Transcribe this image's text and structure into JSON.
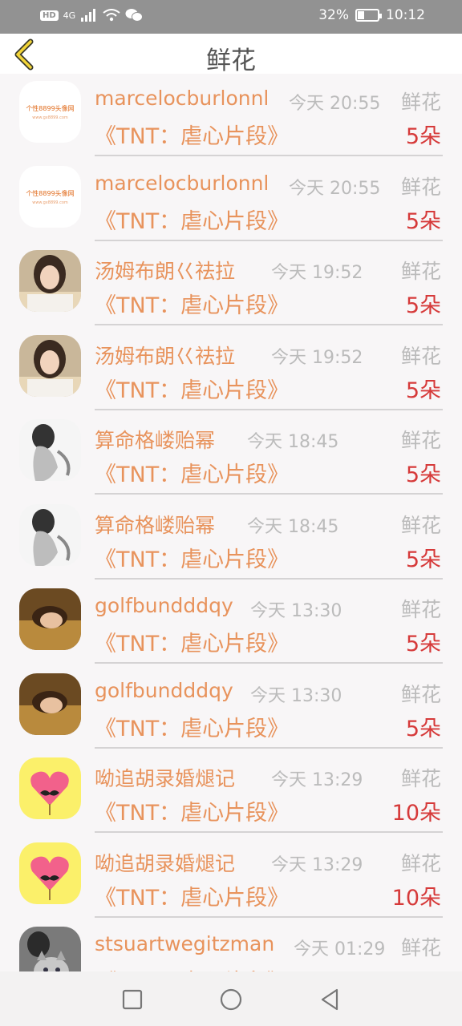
{
  "status_bar": {
    "hd": "HD",
    "network": "4G",
    "battery_pct": "32%",
    "battery_level": 0.32,
    "time": "10:12"
  },
  "header": {
    "title": "鲜花"
  },
  "gifts": [
    {
      "user": "marcelocburlonnl",
      "time": "今天 20:55",
      "kind": "鲜花",
      "movie": "《TNT：虐心片段》",
      "count": "5朵",
      "avatar": "logo-avatar"
    },
    {
      "user": "marcelocburlonnl",
      "time": "今天 20:55",
      "kind": "鲜花",
      "movie": "《TNT：虐心片段》",
      "count": "5朵",
      "avatar": "logo-avatar"
    },
    {
      "user": "汤姆布朗巜祛拉",
      "time": "今天 19:52",
      "kind": "鲜花",
      "movie": "《TNT：虐心片段》",
      "count": "5朵",
      "avatar": "girl-photo-avatar"
    },
    {
      "user": "汤姆布朗巜祛拉",
      "time": "今天 19:52",
      "kind": "鲜花",
      "movie": "《TNT：虐心片段》",
      "count": "5朵",
      "avatar": "girl-photo-avatar"
    },
    {
      "user": "算命格嵝贻幂",
      "time": "今天 18:45",
      "kind": "鲜花",
      "movie": "《TNT：虐心片段》",
      "count": "5朵",
      "avatar": "bw-photo-avatar"
    },
    {
      "user": "算命格嵝贻幂",
      "time": "今天 18:45",
      "kind": "鲜花",
      "movie": "《TNT：虐心片段》",
      "count": "5朵",
      "avatar": "bw-photo-avatar"
    },
    {
      "user": "golfbundddqy",
      "time": "今天 13:30",
      "kind": "鲜花",
      "movie": "《TNT：虐心片段》",
      "count": "5朵",
      "avatar": "field-photo-avatar"
    },
    {
      "user": "golfbundddqy",
      "time": "今天 13:30",
      "kind": "鲜花",
      "movie": "《TNT：虐心片段》",
      "count": "5朵",
      "avatar": "field-photo-avatar"
    },
    {
      "user": "呦追胡录婚煺记",
      "time": "今天 13:29",
      "kind": "鲜花",
      "movie": "《TNT：虐心片段》",
      "count": "10朵",
      "avatar": "heart-mustache-avatar"
    },
    {
      "user": "呦追胡录婚煺记",
      "time": "今天 13:29",
      "kind": "鲜花",
      "movie": "《TNT：虐心片段》",
      "count": "10朵",
      "avatar": "heart-mustache-avatar"
    },
    {
      "user": "stsuartwegitzman",
      "time": "今天 01:29",
      "kind": "鲜花",
      "movie": "《TNT：虐心片段》",
      "count": "",
      "avatar": "cat-photo-avatar"
    }
  ],
  "nav": {
    "icons": [
      "square-recent-icon",
      "circle-home-icon",
      "triangle-back-icon"
    ]
  }
}
